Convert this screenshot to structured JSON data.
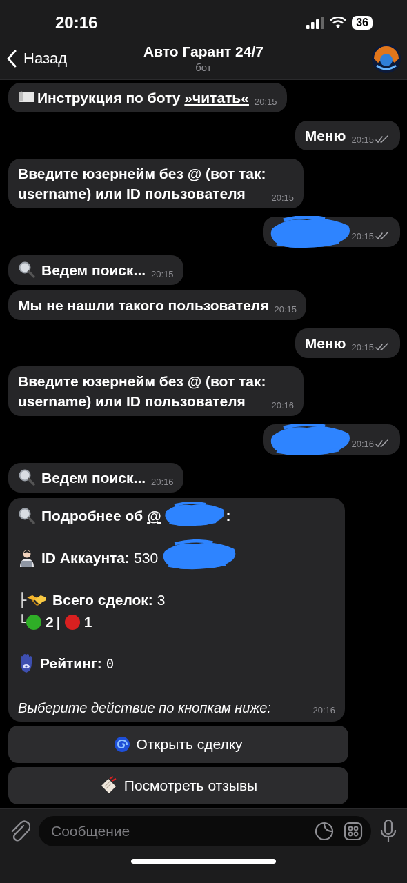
{
  "status_bar": {
    "time": "20:16",
    "battery": "36"
  },
  "header": {
    "back": "Назад",
    "title": "Авто Гарант 24/7",
    "subtitle": "бот"
  },
  "messages": [
    {
      "outgoing": false,
      "kind": "guide",
      "text": "Инструкция по боту ",
      "link": "»читать«",
      "time": "20:15"
    },
    {
      "outgoing": true,
      "kind": "text",
      "text": "Меню",
      "time": "20:15",
      "read": true
    },
    {
      "outgoing": false,
      "kind": "text",
      "text": "Введите юзернейм без @ (вот так:\nusername) или ID пользователя",
      "time": "20:15"
    },
    {
      "outgoing": true,
      "kind": "redacted",
      "time": "20:15",
      "read": true
    },
    {
      "outgoing": false,
      "kind": "search",
      "text": "Ведем поиск...",
      "time": "20:15"
    },
    {
      "outgoing": false,
      "kind": "text",
      "text": "Мы не нашли такого пользователя",
      "time": "20:15"
    },
    {
      "outgoing": true,
      "kind": "text",
      "text": "Меню",
      "time": "20:15",
      "read": true
    },
    {
      "outgoing": false,
      "kind": "text",
      "text": "Введите юзернейм без @ (вот так:\nusername) или ID пользователя",
      "time": "20:16"
    },
    {
      "outgoing": true,
      "kind": "redacted",
      "time": "20:16",
      "read": true
    },
    {
      "outgoing": false,
      "kind": "search",
      "text": "Ведем поиск...",
      "time": "20:16"
    },
    {
      "outgoing": false,
      "kind": "details",
      "title": "Подробнее об ",
      "mention": "@",
      "title_end": ":",
      "account_label": "ID Аккаунта:",
      "account_value": "530",
      "tree_top": "├",
      "deals_label": "Всего сделок:",
      "deals_value": "3",
      "tree_bottom": "└",
      "success": "2",
      "separator": "|",
      "failed": "1",
      "rating_label": "Рейтинг:",
      "rating_value": "0",
      "footer": "Выберите действие по кнопкам ниже:",
      "time": "20:16"
    }
  ],
  "buttons": [
    {
      "kind": "open",
      "label": "Открыть сделку"
    },
    {
      "kind": "reviews",
      "label": "Посмотреть отзывы"
    }
  ],
  "composer": {
    "placeholder": "Сообщение"
  }
}
